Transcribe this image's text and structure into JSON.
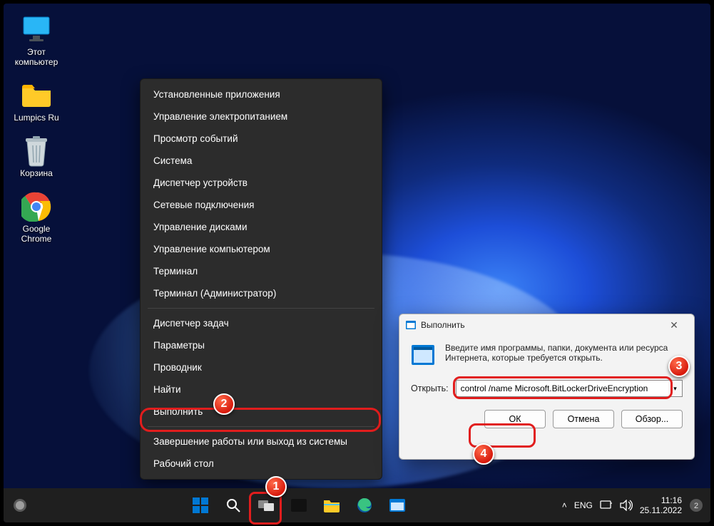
{
  "desktop_icons": [
    {
      "label": "Этот\nкомпьютер"
    },
    {
      "label": "Lumpics Ru"
    },
    {
      "label": "Корзина"
    },
    {
      "label": "Google\nChrome"
    }
  ],
  "context_menu": {
    "items": [
      "Установленные приложения",
      "Управление электропитанием",
      "Просмотр событий",
      "Система",
      "Диспетчер устройств",
      "Сетевые подключения",
      "Управление дисками",
      "Управление компьютером",
      "Терминал",
      "Терминал (Администратор)"
    ],
    "group2": [
      "Диспетчер задач",
      "Параметры",
      "Проводник",
      "Найти",
      "Выполнить"
    ],
    "group3": [
      "Завершение работы или выход из системы",
      "Рабочий стол"
    ]
  },
  "run_dialog": {
    "title": "Выполнить",
    "description": "Введите имя программы, папки, документа или ресурса Интернета, которые требуется открыть.",
    "open_label": "Открыть:",
    "value": "control /name Microsoft.BitLockerDriveEncryption",
    "ok": "ОК",
    "cancel": "Отмена",
    "browse": "Обзор..."
  },
  "taskbar": {
    "lang": "ENG",
    "time": "11:16",
    "date": "25.11.2022"
  },
  "badges": {
    "b1": "1",
    "b2": "2",
    "b3": "3",
    "b4": "4"
  },
  "tray": {
    "chevron": "˄"
  }
}
